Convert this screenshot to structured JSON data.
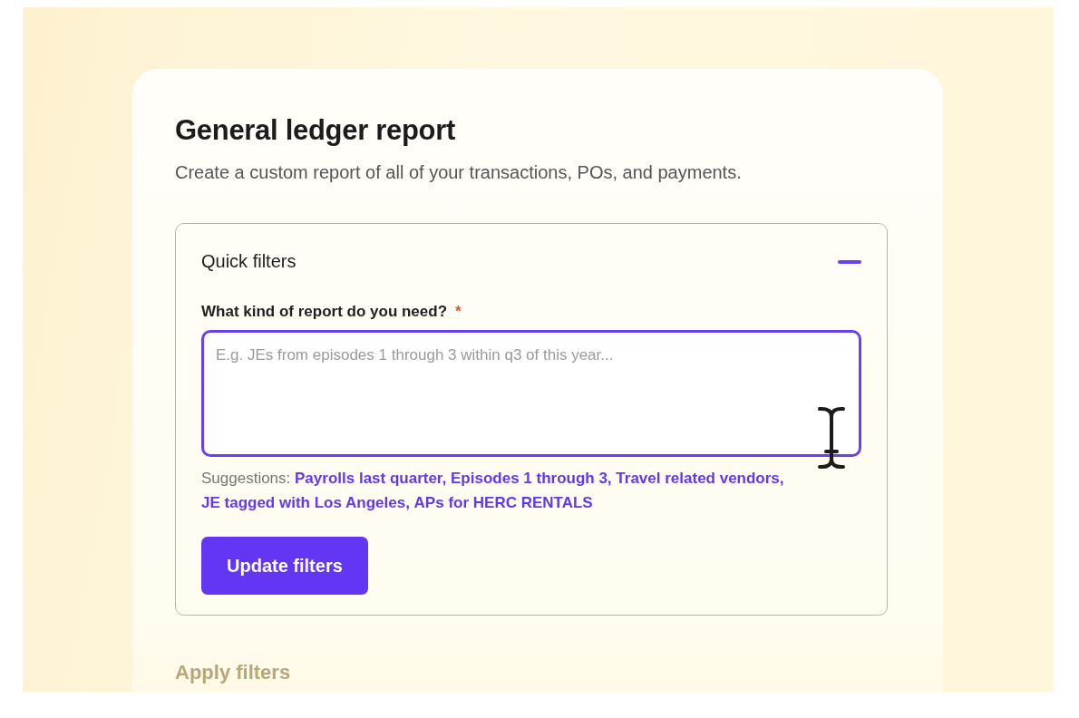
{
  "report": {
    "title": "General ledger report",
    "subtitle": "Create a custom report of all of your transactions, POs, and payments."
  },
  "quick_filters": {
    "title": "Quick filters",
    "expanded": true,
    "field": {
      "label": "What kind of report do you need?",
      "required_mark": "*",
      "placeholder": "E.g. JEs from episodes 1 through 3 within q3 of this year...",
      "focused": true
    },
    "suggestions_label": "Suggestions:",
    "suggestions": [
      "Payrolls last quarter,",
      "Episodes 1 through 3,",
      "Travel related vendors,",
      "JE tagged with Los Angeles,",
      "APs for HERC RENTALS"
    ],
    "button": "Update filters"
  },
  "next_section": {
    "title": "Apply filters"
  }
}
